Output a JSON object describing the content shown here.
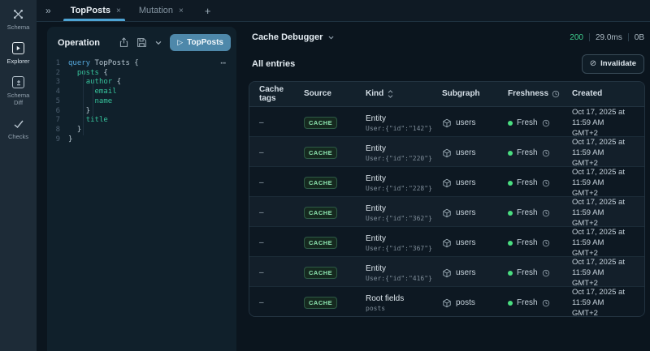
{
  "icons": {
    "collapse": "»",
    "close": "×",
    "add": "+",
    "play_outline": "▷",
    "ellipsis": "⋯",
    "invalidate": "⊘"
  },
  "colors": {
    "accent_blue": "#4ea4d4",
    "run_button_blue": "#4e88aa",
    "status_green": "#3ecf8e",
    "fresh_dot_green": "#4ade80",
    "badge_green": "#8be3ae",
    "keyword_blue": "#55a8dc",
    "field_teal": "#36c29b"
  },
  "sidebar": {
    "items": [
      {
        "label": "Schema",
        "active": false
      },
      {
        "label": "Explorer",
        "active": true
      },
      {
        "label": "Schema Diff",
        "active": false
      },
      {
        "label": "Checks",
        "active": false
      }
    ]
  },
  "tab_bar": {
    "tabs": [
      {
        "label": "TopPosts",
        "active": true
      },
      {
        "label": "Mutation",
        "active": false
      }
    ]
  },
  "operation_panel": {
    "title": "Operation",
    "run_button": {
      "label": "TopPosts"
    },
    "code": {
      "lines": [
        {
          "num": "1",
          "tokens": [
            {
              "t": "kw",
              "s": "query"
            },
            {
              "t": "pl",
              "s": " TopPosts {"
            }
          ]
        },
        {
          "num": "2",
          "tokens": [
            {
              "t": "pl",
              "s": "  "
            },
            {
              "t": "fld",
              "s": "posts"
            },
            {
              "t": "pl",
              "s": " {"
            }
          ]
        },
        {
          "num": "3",
          "tokens": [
            {
              "t": "pl",
              "s": "    "
            },
            {
              "t": "fld",
              "s": "author"
            },
            {
              "t": "pl",
              "s": " {"
            }
          ]
        },
        {
          "num": "4",
          "tokens": [
            {
              "t": "pl",
              "s": "      "
            },
            {
              "t": "fld",
              "s": "email"
            }
          ]
        },
        {
          "num": "5",
          "tokens": [
            {
              "t": "pl",
              "s": "      "
            },
            {
              "t": "fld",
              "s": "name"
            }
          ]
        },
        {
          "num": "6",
          "tokens": [
            {
              "t": "pl",
              "s": "    }"
            }
          ]
        },
        {
          "num": "7",
          "tokens": [
            {
              "t": "pl",
              "s": "    "
            },
            {
              "t": "fld",
              "s": "title"
            }
          ]
        },
        {
          "num": "8",
          "tokens": [
            {
              "t": "pl",
              "s": "  }"
            }
          ]
        },
        {
          "num": "9",
          "tokens": [
            {
              "t": "pl",
              "s": "}"
            }
          ]
        }
      ]
    }
  },
  "cache_debugger": {
    "title": "Cache Debugger",
    "stats": {
      "status_code": "200",
      "duration": "29.0ms",
      "size": "0B"
    },
    "section_title": "All entries",
    "invalidate_label": "Invalidate",
    "table": {
      "columns": [
        "Cache tags",
        "Source",
        "Kind",
        "Subgraph",
        "Freshness",
        "Created"
      ],
      "rows": [
        {
          "cache_tags": "–",
          "source": "CACHE",
          "kind_title": "Entity",
          "kind_sub": "User:{\"id\":\"142\"}",
          "subgraph": "users",
          "freshness": "Fresh",
          "created_line1": "Oct 17, 2025 at 11:59 AM",
          "created_line2": "GMT+2"
        },
        {
          "cache_tags": "–",
          "source": "CACHE",
          "kind_title": "Entity",
          "kind_sub": "User:{\"id\":\"220\"}",
          "subgraph": "users",
          "freshness": "Fresh",
          "created_line1": "Oct 17, 2025 at 11:59 AM",
          "created_line2": "GMT+2"
        },
        {
          "cache_tags": "–",
          "source": "CACHE",
          "kind_title": "Entity",
          "kind_sub": "User:{\"id\":\"228\"}",
          "subgraph": "users",
          "freshness": "Fresh",
          "created_line1": "Oct 17, 2025 at 11:59 AM",
          "created_line2": "GMT+2"
        },
        {
          "cache_tags": "–",
          "source": "CACHE",
          "kind_title": "Entity",
          "kind_sub": "User:{\"id\":\"362\"}",
          "subgraph": "users",
          "freshness": "Fresh",
          "created_line1": "Oct 17, 2025 at 11:59 AM",
          "created_line2": "GMT+2"
        },
        {
          "cache_tags": "–",
          "source": "CACHE",
          "kind_title": "Entity",
          "kind_sub": "User:{\"id\":\"367\"}",
          "subgraph": "users",
          "freshness": "Fresh",
          "created_line1": "Oct 17, 2025 at 11:59 AM",
          "created_line2": "GMT+2"
        },
        {
          "cache_tags": "–",
          "source": "CACHE",
          "kind_title": "Entity",
          "kind_sub": "User:{\"id\":\"416\"}",
          "subgraph": "users",
          "freshness": "Fresh",
          "created_line1": "Oct 17, 2025 at 11:59 AM",
          "created_line2": "GMT+2"
        },
        {
          "cache_tags": "–",
          "source": "CACHE",
          "kind_title": "Root fields",
          "kind_sub": "posts",
          "subgraph": "posts",
          "freshness": "Fresh",
          "created_line1": "Oct 17, 2025 at 11:59 AM",
          "created_line2": "GMT+2"
        }
      ]
    }
  }
}
